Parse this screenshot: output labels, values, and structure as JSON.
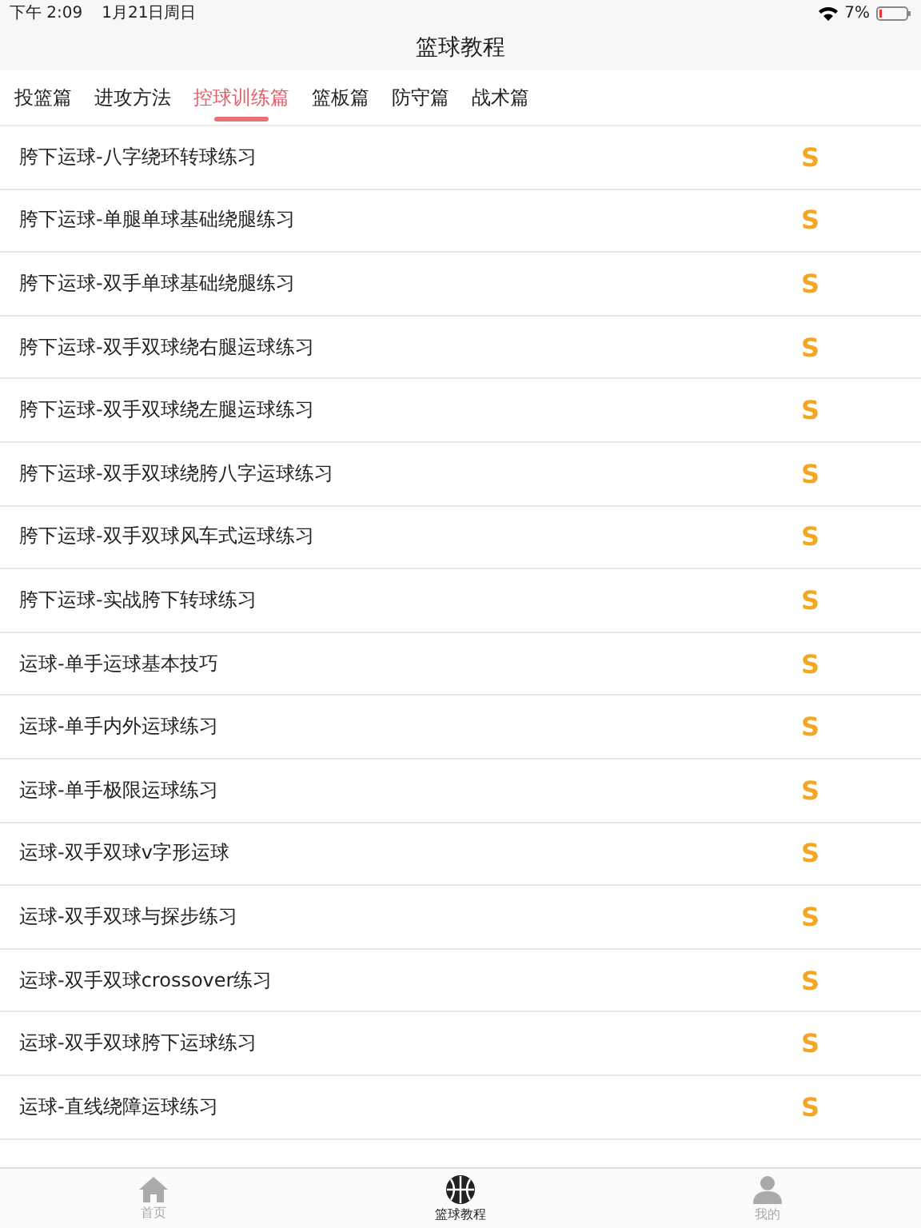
{
  "status_bar": {
    "time": "下午 2:09",
    "date": "1月21日周日",
    "battery": "7%"
  },
  "nav": {
    "title": "篮球教程"
  },
  "tabs": [
    {
      "label": "投篮篇",
      "selected": false
    },
    {
      "label": "进攻方法",
      "selected": false
    },
    {
      "label": "控球训练篇",
      "selected": true
    },
    {
      "label": "篮板篇",
      "selected": false
    },
    {
      "label": "防守篇",
      "selected": false
    },
    {
      "label": "战术篇",
      "selected": false
    }
  ],
  "rows": [
    {
      "title": "胯下运球-八字绕环转球练习",
      "badge": "S"
    },
    {
      "title": "胯下运球-单腿单球基础绕腿练习",
      "badge": "S"
    },
    {
      "title": "胯下运球-双手单球基础绕腿练习",
      "badge": "S"
    },
    {
      "title": "胯下运球-双手双球绕右腿运球练习",
      "badge": "S"
    },
    {
      "title": "胯下运球-双手双球绕左腿运球练习",
      "badge": "S"
    },
    {
      "title": "胯下运球-双手双球绕胯八字运球练习",
      "badge": "S"
    },
    {
      "title": "胯下运球-双手双球风车式运球练习",
      "badge": "S"
    },
    {
      "title": "胯下运球-实战胯下转球练习",
      "badge": "S"
    },
    {
      "title": "运球-单手运球基本技巧",
      "badge": "S"
    },
    {
      "title": "运球-单手内外运球练习",
      "badge": "S"
    },
    {
      "title": "运球-单手极限运球练习",
      "badge": "S"
    },
    {
      "title": "运球-双手双球v字形运球",
      "badge": "S"
    },
    {
      "title": "运球-双手双球与探步练习",
      "badge": "S"
    },
    {
      "title": "运球-双手双球crossover练习",
      "badge": "S"
    },
    {
      "title": "运球-双手双球胯下运球练习",
      "badge": "S"
    },
    {
      "title": "运球-直线绕障运球练习",
      "badge": "S"
    }
  ],
  "tab_bar": [
    {
      "label": "首页",
      "kind": "home",
      "selected": false
    },
    {
      "label": "篮球教程",
      "kind": "ball",
      "selected": true
    },
    {
      "label": "我的",
      "kind": "person",
      "selected": false
    }
  ]
}
